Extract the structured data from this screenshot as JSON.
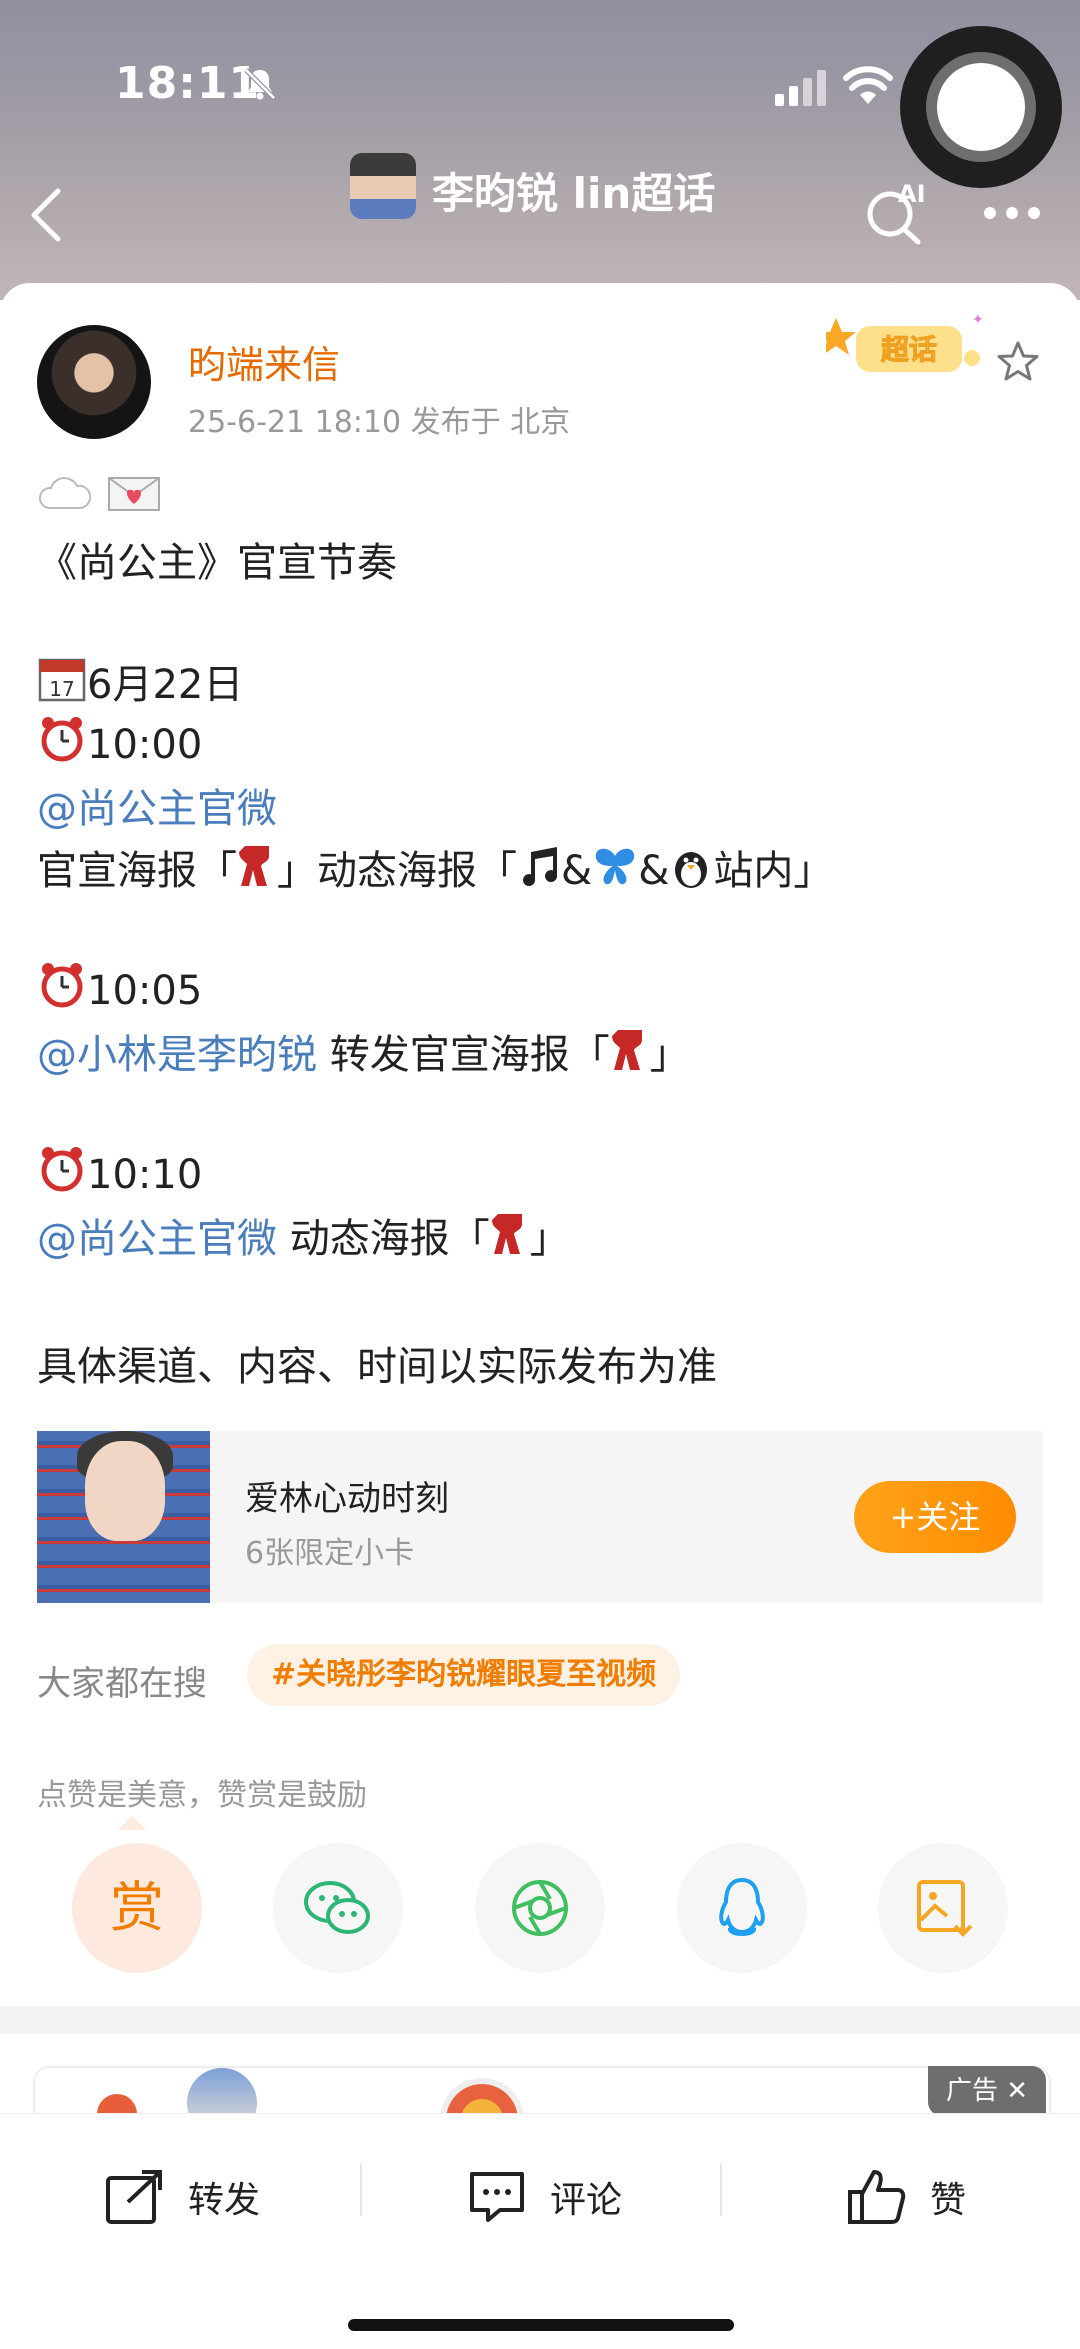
{
  "status_bar": {
    "time": "18:11"
  },
  "header": {
    "topic_title": "李昀锐 lin超话",
    "ai_label": "AI"
  },
  "post": {
    "author": "昀端来信",
    "meta": "25-6-21 18:10  发布于 北京",
    "badge_label": "超话",
    "lines": {
      "l1": "《尚公主》官宣节奏",
      "date": "6月22日",
      "t1": "10:00",
      "m1": "@尚公主官微",
      "l2_a": "官宣海报「",
      "l2_b": "」动态海报「",
      "l2_c": "&",
      "l2_d": "&",
      "l2_e": "站内」",
      "t2": "10:05",
      "m2": "@小林是李昀锐",
      "l3_a": " 转发官宣海报「",
      "l3_b": "」",
      "t3": "10:10",
      "m3": "@尚公主官微",
      "l4_a": " 动态海报「",
      "l4_b": "」",
      "l5": "具体渠道、内容、时间以实际发布为准"
    }
  },
  "promo": {
    "title": "爱林心动时刻",
    "subtitle": "6张限定小卡",
    "follow_label": "+关注"
  },
  "search": {
    "label": "大家都在搜",
    "tag": "#关晓彤李昀锐耀眼夏至视频"
  },
  "share": {
    "hint": "点赞是美意，赞赏是鼓励",
    "reward_char": "赏"
  },
  "ad": {
    "label": "广告 ✕"
  },
  "bottom_bar": {
    "repost": "转发",
    "comment": "评论",
    "like": "赞"
  },
  "colors": {
    "accent": "#ff8c00",
    "mention": "#4a7dbb",
    "author": "#e56a00"
  }
}
